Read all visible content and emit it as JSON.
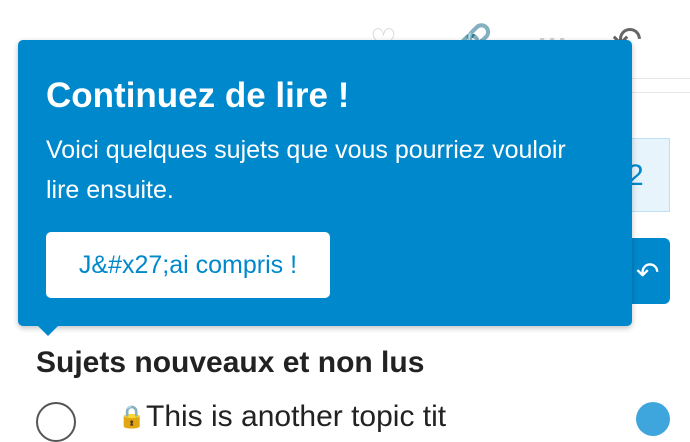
{
  "toolbar": {
    "icons": [
      "heart-icon",
      "link-icon",
      "more-icon",
      "reply-icon"
    ],
    "heart_glyph": "♡",
    "link_glyph": "🔗",
    "more_glyph": "···",
    "reply_glyph": "↶"
  },
  "pager": {
    "value": "2"
  },
  "reply_button": {
    "glyph": "↶"
  },
  "tooltip": {
    "title": "Continuez de lire !",
    "text": "Voici quelques sujets que vous pourriez vouloir lire ensuite.",
    "button_label": "J&#x27;ai compris !"
  },
  "section": {
    "title": "Sujets nouveaux et non lus"
  },
  "topic": {
    "icon_glyph": "🔒",
    "title": "This is another topic tit"
  },
  "colors": {
    "accent": "#0088cc",
    "badge": "#3fa6dd",
    "text": "#222222"
  }
}
